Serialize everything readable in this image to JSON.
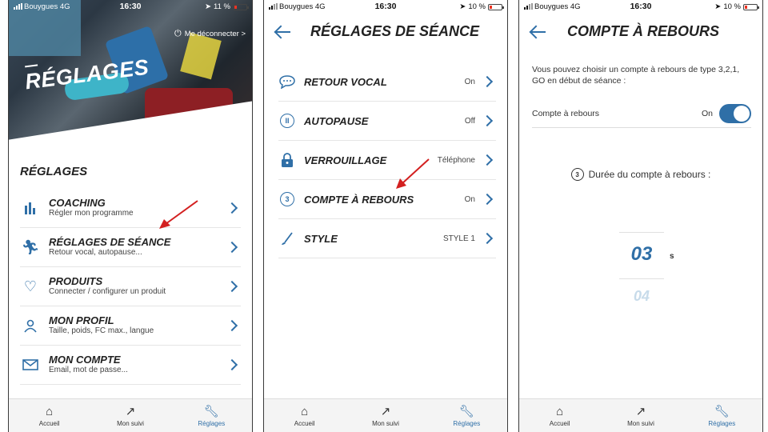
{
  "screens": {
    "settings": {
      "status": {
        "carrier": "Bouygues 4G",
        "time": "16:30",
        "battery": "11 %"
      },
      "logout": "Me déconnecter >",
      "hero_title": "RÉGLAGES",
      "section_title": "RÉGLAGES",
      "items": [
        {
          "title": "COACHING",
          "subtitle": "Régler mon programme",
          "icon": "bar-chart-icon"
        },
        {
          "title": "RÉGLAGES DE SÉANCE",
          "subtitle": "Retour vocal, autopause...",
          "icon": "runner-icon"
        },
        {
          "title": "PRODUITS",
          "subtitle": "Connecter / configurer un produit",
          "icon": "heart-icon"
        },
        {
          "title": "MON PROFIL",
          "subtitle": "Taille, poids, FC max., langue",
          "icon": "user-icon"
        },
        {
          "title": "MON COMPTE",
          "subtitle": "Email, mot de passe...",
          "icon": "envelope-icon"
        }
      ]
    },
    "session": {
      "status": {
        "carrier": "Bouygues 4G",
        "time": "16:30",
        "battery": "10 %"
      },
      "title": "RÉGLAGES DE SÉANCE",
      "items": [
        {
          "title": "RETOUR VOCAL",
          "value": "On",
          "icon": "speech-bubble-icon"
        },
        {
          "title": "AUTOPAUSE",
          "value": "Off",
          "icon": "pause-icon"
        },
        {
          "title": "VERROUILLAGE",
          "value": "Téléphone",
          "icon": "lock-icon"
        },
        {
          "title": "COMPTE À REBOURS",
          "value": "On",
          "icon": "countdown-icon"
        },
        {
          "title": "STYLE",
          "value": "STYLE 1",
          "icon": "brush-icon"
        }
      ]
    },
    "countdown": {
      "status": {
        "carrier": "Bouygues 4G",
        "time": "16:30",
        "battery": "10 %"
      },
      "title": "COMPTE À REBOURS",
      "description": "Vous pouvez choisir un compte à rebours de type 3,2,1, GO en début de séance :",
      "toggle_label": "Compte à rebours",
      "toggle_value": "On",
      "duration_label": "Durée du compte à rebours :",
      "picker_selected": "03",
      "picker_next": "04",
      "unit": "s",
      "countdown_digit": "3"
    }
  },
  "tabbar": {
    "home": "Accueil",
    "tracking": "Mon suivi",
    "settings": "Réglages"
  },
  "colors": {
    "accent": "#2f6fa7",
    "arrow": "#d32020"
  }
}
